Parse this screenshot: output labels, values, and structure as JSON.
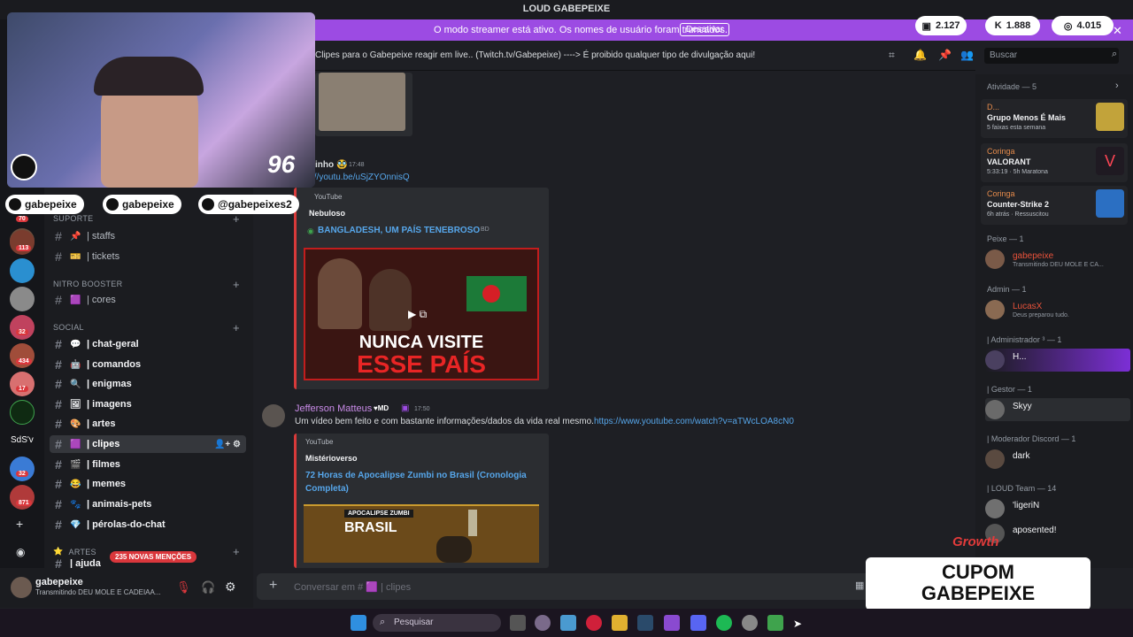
{
  "window": {
    "title": "LOUD GABEPEIXE"
  },
  "banner": {
    "message": "O modo streamer está ativo. Os nomes de usuário foram truncados.",
    "button": "Desativar"
  },
  "stream_stats": [
    {
      "icon": "chat-icon",
      "value": "2.127"
    },
    {
      "icon": "kick-icon",
      "value": "1.888"
    },
    {
      "icon": "globe-icon",
      "value": "4.015"
    }
  ],
  "webcam": {
    "overlay_number": "96"
  },
  "socials": [
    {
      "icon": "youtube-icon",
      "label": "gabepeixe"
    },
    {
      "icon": "instagram-icon",
      "label": "gabepeixe"
    },
    {
      "icon": "tiktok-icon",
      "label": "@gabepeixes2"
    }
  ],
  "guild_badges": [
    "70",
    "113",
    "32",
    "434",
    "17",
    "32",
    "871"
  ],
  "guild_labels": {
    "sdsv": "SdS'v"
  },
  "categories": {
    "suporte": "SUPORTE",
    "nitro": "NITRO BOOSTER",
    "social": "SOCIAL",
    "artes": "ARTES"
  },
  "channels": {
    "staffs": "| staffs",
    "tickets": "| tickets",
    "cores": "| cores",
    "chat_geral": "| chat-geral",
    "comandos": "| comandos",
    "enigmas": "| enigmas",
    "imagens": "| imagens",
    "artes": "| artes",
    "clipes": "| clipes",
    "filmes": "| filmes",
    "memes": "| memes",
    "animais": "| animais-pets",
    "perolas": "| pérolas-do-chat",
    "ajuda": "| ajuda"
  },
  "mentions_badge": "235 NOVAS MENÇÕES",
  "user_panel": {
    "name": "gabepeixe",
    "status": "Transmitindo DEU MOLE E CADEIAA..."
  },
  "topic": {
    "channel_fragment": "es",
    "text": "Clipes para o Gabepeixe reagir em live.. (Twitch.tv/Gabepeixe) ----> É proibido qualquer tipo de divulgação aqui!",
    "search_placeholder": "Buscar"
  },
  "messages": {
    "m1": {
      "author": "inho",
      "time": "17:48",
      "link": "://youtu.be/uSjZYOnnisQ"
    },
    "embed1": {
      "provider": "YouTube",
      "author": "Nebuloso",
      "title": "BANGLADESH, UM PAÍS TENEBROSO",
      "thumb_line1": "NUNCA VISITE",
      "thumb_line2": "ESSE PAÍS"
    },
    "m2": {
      "author": "Jefferson Matteus",
      "tag": "MD",
      "time": "17:50",
      "text": "Um vídeo bem feito e com bastante informações/dados da vida real mesmo.",
      "link": "https://www.youtube.com/watch?v=aTWcLOA8cN0"
    },
    "embed2": {
      "provider": "YouTube",
      "author": "Mistérioverso",
      "title": "72 Horas de Apocalipse Zumbi no Brasil (Cronologia Completa)",
      "thumb_line1": "APOCALIPSE ZUMBI",
      "thumb_line2": "BRASIL"
    }
  },
  "composer": {
    "placeholder": "Conversar em # 🟪 | clipes"
  },
  "members": {
    "activity_header": "Atividade — 5",
    "activities": [
      {
        "user": "D...",
        "title": "Grupo Menos É Mais",
        "detail": "5 faixas esta semana"
      },
      {
        "user": "Coringa",
        "title": "VALORANT",
        "detail": "5:33:19 · 5h Maratona"
      },
      {
        "user": "Coringa",
        "title": "Counter-Strike 2",
        "detail": "6h atrás · Ressuscitou"
      }
    ],
    "groups": [
      {
        "header": "Peixe — 1",
        "name": "gabepeixe",
        "sub": "Transmitindo DEU MOLE E CA..."
      },
      {
        "header": "Admin — 1",
        "name": "LucasX",
        "sub": "Deus preparou tudo."
      },
      {
        "header": "| Administrador ³ — 1",
        "name": "H...",
        "sub": ""
      },
      {
        "header": "| Gestor — 1",
        "name": "Skyy",
        "sub": ""
      },
      {
        "header": "| Moderador Discord — 1",
        "name": "dark",
        "sub": ""
      },
      {
        "header": "| LOUD Team — 14",
        "name": "'ligeriN",
        "sub": ""
      },
      {
        "header": "",
        "name": "aposented!",
        "sub": ""
      }
    ]
  },
  "overlay": {
    "growth": "Growth",
    "cupom_line1": "CUPOM",
    "cupom_line2": "GABEPEIXE"
  },
  "taskbar": {
    "search_placeholder": "Pesquisar"
  },
  "colors": {
    "discord_bg": "#1e1f24",
    "banner": "#9c4be3",
    "link": "#56a6ea",
    "embed_border": "#d83a3a"
  }
}
